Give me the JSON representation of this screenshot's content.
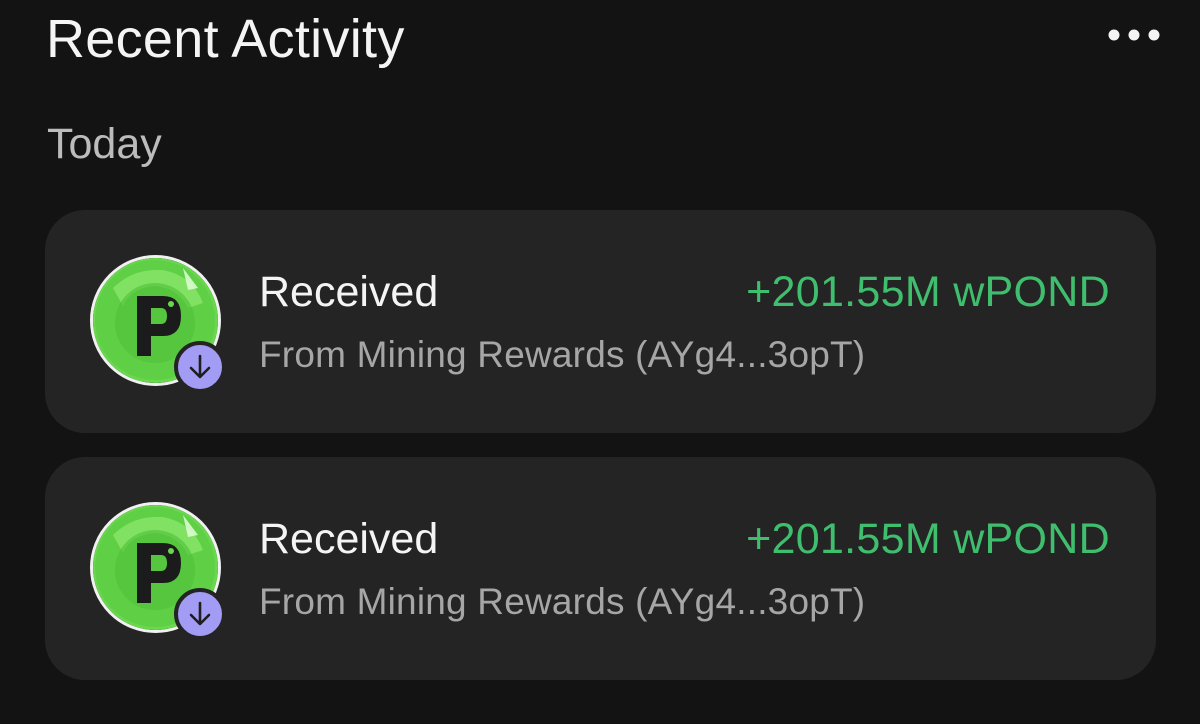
{
  "header": {
    "title": "Recent Activity",
    "more_icon": "more-horizontal-icon"
  },
  "sections": [
    {
      "label": "Today",
      "items": [
        {
          "title": "Received",
          "subtitle": "From Mining Rewards (AYg4...3opT)",
          "amount": "+201.55M wPOND",
          "token_icon": "pond-token-icon",
          "badge_icon": "arrow-down-icon"
        },
        {
          "title": "Received",
          "subtitle": "From Mining Rewards (AYg4...3opT)",
          "amount": "+201.55M wPOND",
          "token_icon": "pond-token-icon",
          "badge_icon": "arrow-down-icon"
        }
      ]
    }
  ],
  "colors": {
    "background": "#131313",
    "card": "#242424",
    "amount_positive": "#3fbf6e",
    "badge": "#a39cf5",
    "token_green": "#5fd64a"
  }
}
